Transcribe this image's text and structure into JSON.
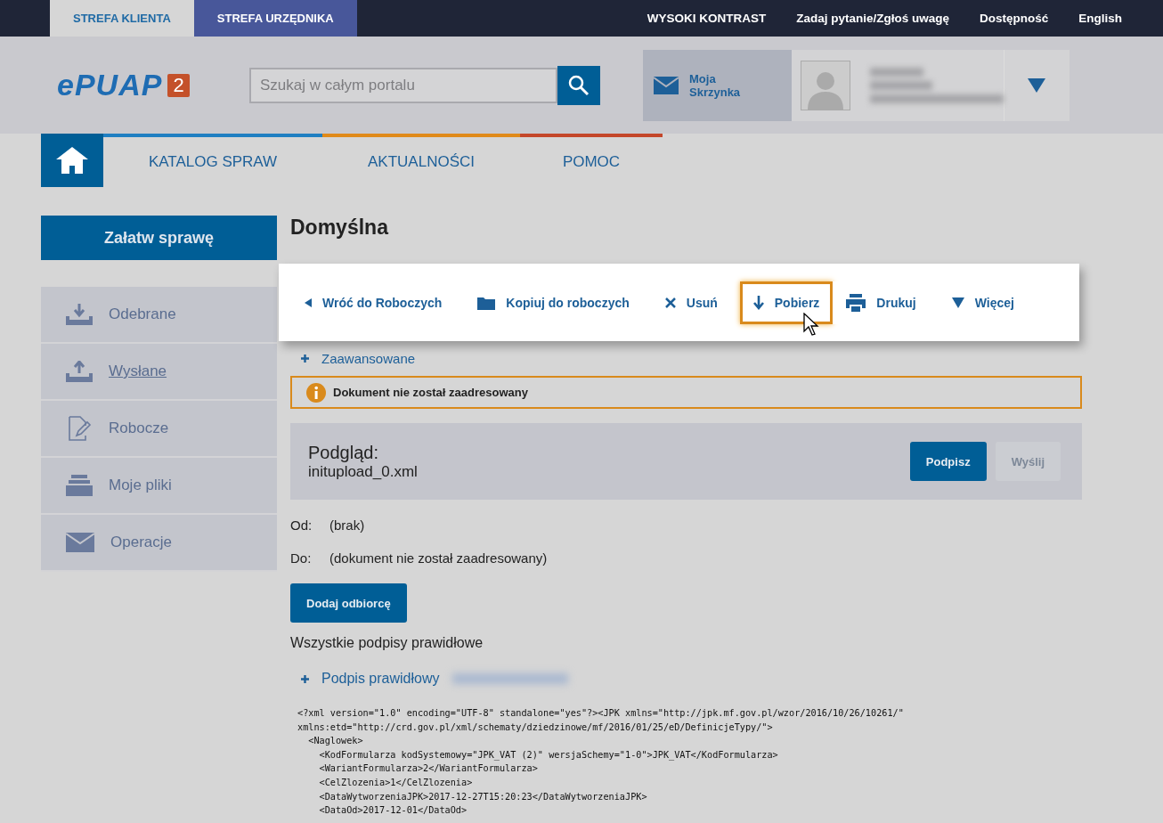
{
  "zones": [
    {
      "label": "STREFA KLIENTA",
      "selected": true
    },
    {
      "label": "STREFA URZĘDNIKA",
      "selected": false
    }
  ],
  "top_links": [
    "WYSOKI KONTRAST",
    "Zadaj pytanie/Zgłoś uwagę",
    "Dostępność",
    "English"
  ],
  "logo": {
    "name": "ePUAP",
    "badge": "2"
  },
  "search": {
    "placeholder": "Szukaj w całym portalu"
  },
  "mailbox": {
    "label": "Moja Skrzynka"
  },
  "nav": [
    {
      "label": "KATALOG SPRAW",
      "color": "#1f7fc2"
    },
    {
      "label": "AKTUALNOŚCI",
      "color": "#e08a1a"
    },
    {
      "label": "POMOC",
      "color": "#c4472a"
    }
  ],
  "sidebar": {
    "action": "Załatw sprawę",
    "items": [
      {
        "label": "Odebrane",
        "kind": "inbox",
        "selected": false
      },
      {
        "label": "Wysłane",
        "kind": "outbox",
        "selected": true
      },
      {
        "label": "Robocze",
        "kind": "draft",
        "selected": false
      },
      {
        "label": "Moje pliki",
        "kind": "files",
        "selected": false
      },
      {
        "label": "Operacje",
        "kind": "mail",
        "selected": false
      }
    ]
  },
  "title": "Domyślna",
  "toolbar": [
    {
      "label": "Wróć do Roboczych",
      "kind": "back",
      "focused": false
    },
    {
      "label": "Kopiuj do roboczych",
      "kind": "folder",
      "focused": false
    },
    {
      "label": "Usuń",
      "kind": "delete",
      "focused": false
    },
    {
      "label": "Pobierz",
      "kind": "download",
      "focused": true
    },
    {
      "label": "Drukuj",
      "kind": "print",
      "focused": false
    },
    {
      "label": "Więcej",
      "kind": "more",
      "focused": false
    }
  ],
  "advanced": "Zaawansowane",
  "alert": "Dokument nie został zaadresowany",
  "preview": {
    "heading": "Podgląd:",
    "file": "initupload_0.xml",
    "buttons": [
      {
        "label": "Podpisz",
        "disabled": false
      },
      {
        "label": "Wyślij",
        "disabled": true
      }
    ]
  },
  "fields": [
    {
      "label": "Od:",
      "value": "(brak)"
    },
    {
      "label": "Do:",
      "value": "(dokument nie został zaadresowany)"
    }
  ],
  "add_recipient": "Dodaj odbiorcę",
  "signatures_status": "Wszystkie podpisy prawidłowe",
  "signature": "Podpis prawidłowy",
  "xml_lines": [
    "<?xml version=\"1.0\" encoding=\"UTF-8\" standalone=\"yes\"?><JPK xmlns=\"http://jpk.mf.gov.pl/wzor/2016/10/26/10261/\"",
    "xmlns:etd=\"http://crd.gov.pl/xml/schematy/dziedzinowe/mf/2016/01/25/eD/DefinicjeTypy/\">",
    "  <Naglowek>",
    "    <KodFormularza kodSystemowy=\"JPK_VAT (2)\" wersjaSchemy=\"1-0\">JPK_VAT</KodFormularza>",
    "    <WariantFormularza>2</WariantFormularza>",
    "    <CelZlozenia>1</CelZlozenia>",
    "    <DataWytworzeniaJPK>2017-12-27T15:20:23</DataWytworzeniaJPK>",
    "    <DataOd>2017-12-01</DataOd>"
  ]
}
